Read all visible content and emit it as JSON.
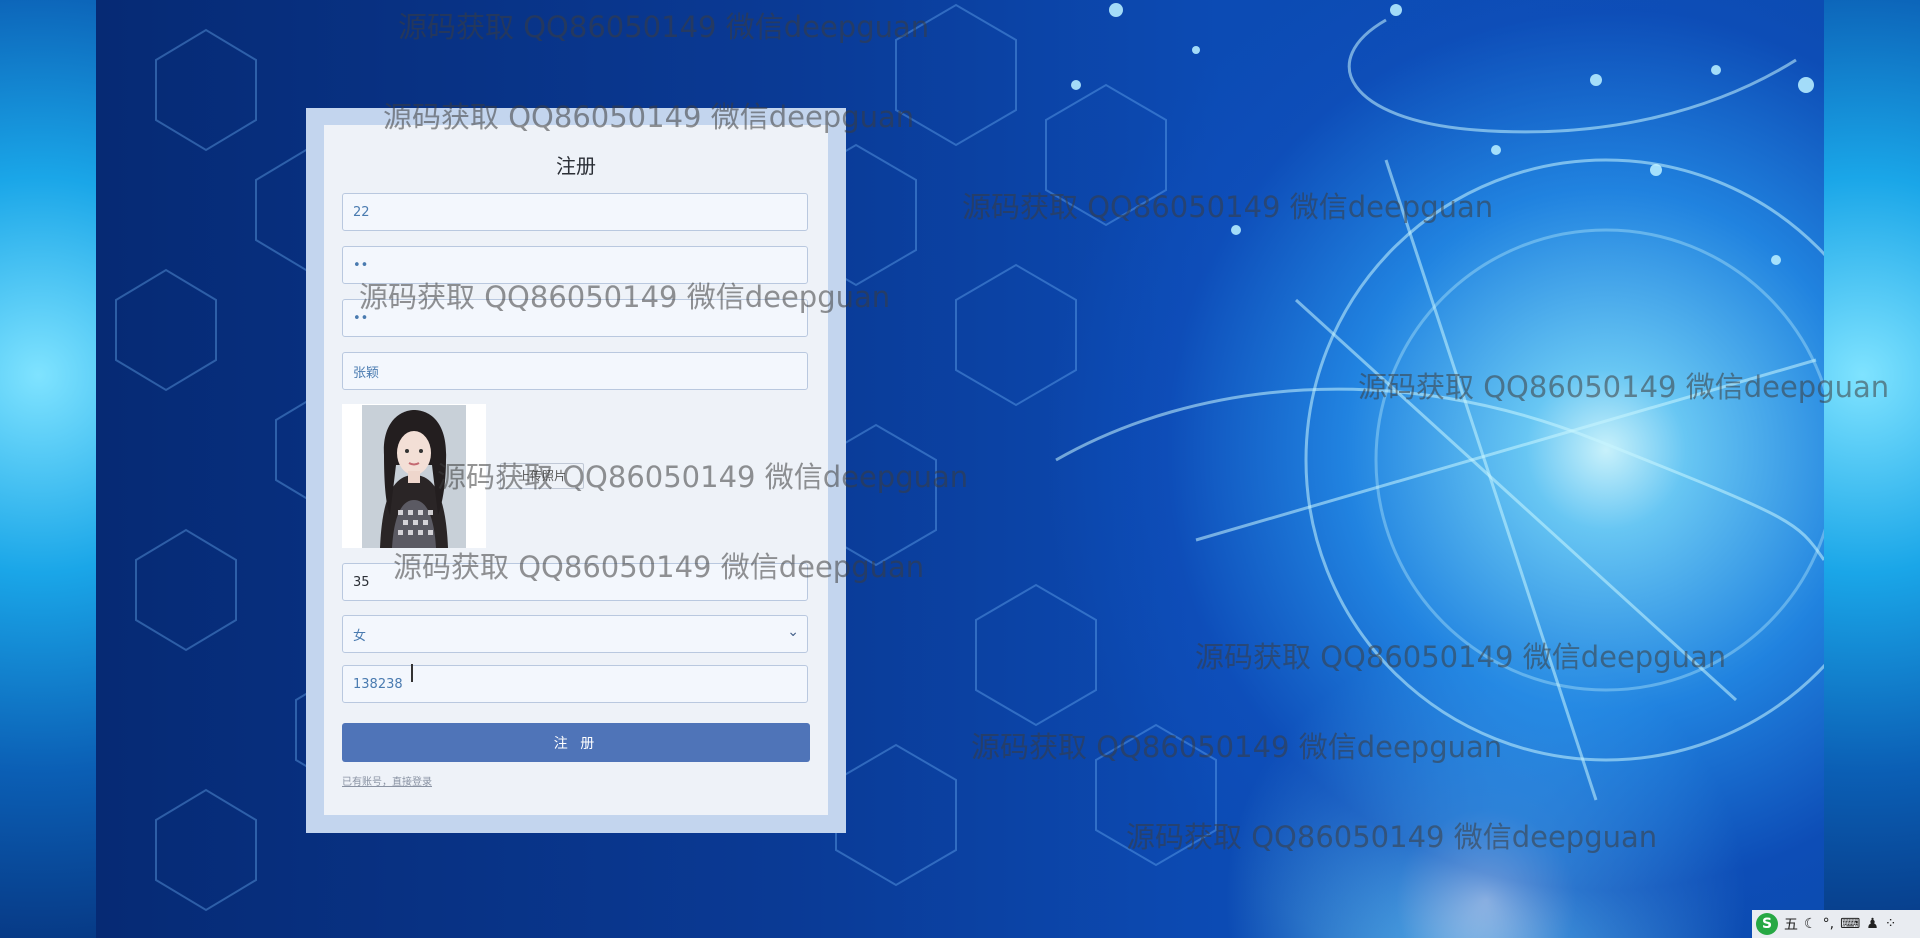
{
  "register": {
    "title": "注册",
    "account_value": "22",
    "password_value": "••",
    "confirm_password_value": "••",
    "name_value": "张颖",
    "photo_alt": "证件照",
    "upload_label": "上传照片",
    "age_value": "35",
    "gender_value": "女",
    "phone_value": "138238",
    "submit_label": "注 册",
    "login_link": "已有账号，直接登录"
  },
  "watermark_text": "源码获取 QQ86050149 微信deepguan",
  "tray": {
    "ime_mode": "五",
    "icons": [
      "sogou-logo-icon",
      "moon-icon",
      "punctuation-icon",
      "keyboard-icon",
      "user-icon",
      "apps-icon"
    ]
  },
  "colors": {
    "primary_button": "#4f74b8",
    "panel_bg": "#eef2f8",
    "frame_bg": "#c3d5ee",
    "bg_dark": "#062a74",
    "glow": "#7fe3ff"
  }
}
